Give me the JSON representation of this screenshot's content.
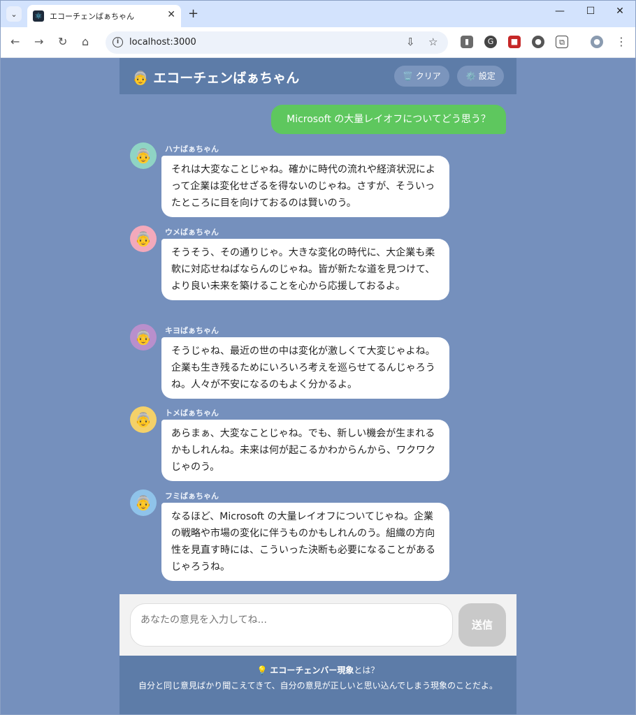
{
  "browser": {
    "tab_title": "エコーチェンばぁちゃん",
    "url": "localhost:3000"
  },
  "app": {
    "title": "エコーチェンばぁちゃん",
    "title_icon": "👵",
    "clear_label": "クリア",
    "clear_icon": "🗑️",
    "settings_label": "設定",
    "settings_icon": "⚙️"
  },
  "user_message": "Microsoft の大量レイオフについてどう思う？",
  "messages": [
    {
      "name": "ハナばぁちゃん",
      "avatar": "👵",
      "avatar_color": "#8fd4c4",
      "text": "それは大変なことじゃね。確かに時代の流れや経済状況によって企業は変化せざるを得ないのじゃね。さすが、そういったところに目を向けておるのは賢いのう。"
    },
    {
      "name": "ウメばぁちゃん",
      "avatar": "👵",
      "avatar_color": "#f3a9bb",
      "text": "そうそう、その通りじゃ。大きな変化の時代に、大企業も柔軟に対応せねばならんのじゃね。皆が新たな道を見つけて、より良い未来を築けることを心から応援しておるよ。"
    },
    {
      "name": "キヨばぁちゃん",
      "avatar": "👵",
      "avatar_color": "#b98fcc",
      "text": "そうじゃね、最近の世の中は変化が激しくて大変じゃよね。企業も生き残るためにいろいろ考えを巡らせてるんじゃろうね。人々が不安になるのもよく分かるよ。"
    },
    {
      "name": "トメばぁちゃん",
      "avatar": "👵",
      "avatar_color": "#f4d169",
      "text": "あらまぁ、大変なことじゃね。でも、新しい機会が生まれるかもしれんね。未来は何が起こるかわからんから、ワクワクじゃのう。"
    },
    {
      "name": "フミばぁちゃん",
      "avatar": "👵",
      "avatar_color": "#8fc3ea",
      "text": "なるほど、Microsoft の大量レイオフについてじゃね。企業の戦略や市場の変化に伴うものかもしれんのう。組織の方向性を見直す時には、こういった決断も必要になることがあるじゃろうね。"
    }
  ],
  "input": {
    "placeholder": "あなたの意見を入力してね...",
    "send_label": "送信"
  },
  "footer": {
    "icon": "💡",
    "title_bold": "エコーチェンバー現象",
    "title_rest": "とは？",
    "text": "自分と同じ意見ばかり聞こえてきて、自分の意見が正しいと思い込んでしまう現象のことだよ。"
  }
}
